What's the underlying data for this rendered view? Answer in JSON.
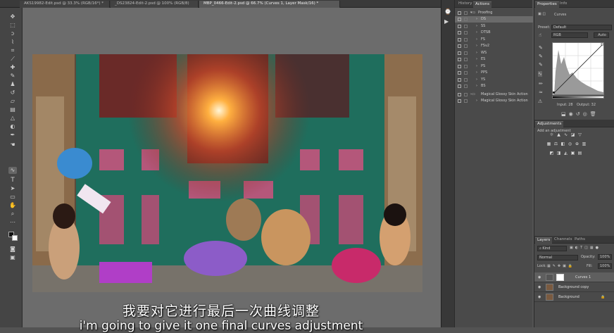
{
  "tabs": [
    {
      "label": "AKS19982-Edit.psd @ 33.3% (RGB/16*) *"
    },
    {
      "label": "_DS23824-Edit-2.psd @ 100% (RGB/8)"
    },
    {
      "label": "MBP_0466-Edit-2.psd @ 66.7% (Curves 1, Layer Mask/16) *"
    }
  ],
  "actions_panel": {
    "tabs": [
      "History",
      "Actions"
    ],
    "set_name": "Proofing",
    "items": [
      "DS",
      "SS",
      "DTSB",
      "FS",
      "FSv2",
      "WS",
      "ES",
      "PS",
      "PPS",
      "YS",
      "BS"
    ],
    "extra": [
      "Magical Glossy Skin Action",
      "Magical Glossy Skin Action"
    ]
  },
  "properties": {
    "tabs": [
      "Properties",
      "Info"
    ],
    "title": "Curves",
    "preset_label": "Preset:",
    "preset_value": "Default",
    "channel": "RGB",
    "auto_label": "Auto",
    "input_label": "Input: 28",
    "output_label": "Output: 32"
  },
  "adjustments": {
    "tab": "Adjustments",
    "add_label": "Add an adjustment"
  },
  "layers": {
    "tabs": [
      "Layers",
      "Channels",
      "Paths"
    ],
    "kind": "Kind",
    "blend": "Normal",
    "opacity_label": "Opacity:",
    "opacity": "100%",
    "lock_label": "Lock:",
    "fill_label": "Fill:",
    "fill": "100%",
    "rows": [
      {
        "name": "Curves 1"
      },
      {
        "name": "Background copy"
      },
      {
        "name": "Background"
      }
    ]
  },
  "subtitles": {
    "zh": "我要对它进行最后一次曲线调整",
    "en": "i'm going to give it one final curves adjustment"
  }
}
